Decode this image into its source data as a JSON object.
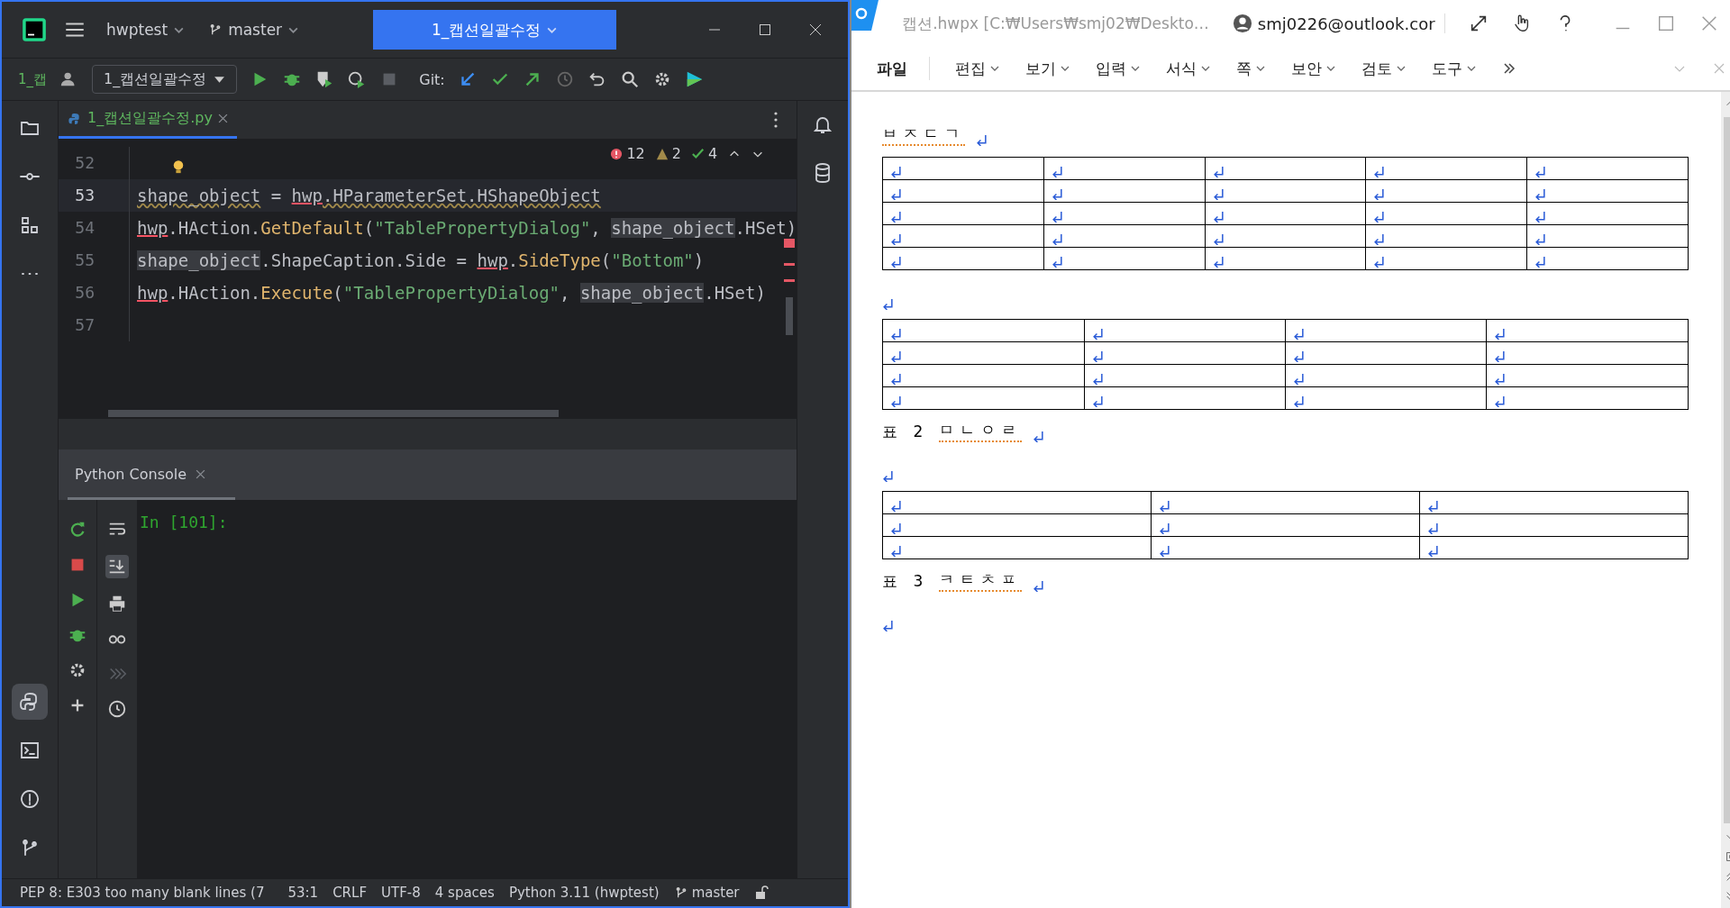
{
  "ide": {
    "title_bar": {
      "project": "hwptest",
      "branch": "master",
      "run_config": "1_캡션일괄수정"
    },
    "toolbar": {
      "project_short": "1_캡",
      "config": "1_캡션일괄수정",
      "git_label": "Git:"
    },
    "editor_tab": {
      "label": "1_캡션일괄수정.py",
      "selected": true
    },
    "inspections": {
      "errors": "12",
      "warnings": "2",
      "weak": "4"
    },
    "code_lines": [
      {
        "number": "52",
        "selected": false
      },
      {
        "number": "53",
        "selected": true,
        "tokens": [
          {
            "kind": "warn",
            "text": "shape_object"
          },
          {
            "kind": "plain",
            "text": " = "
          },
          {
            "kind": "module",
            "text": "hwp"
          },
          {
            "kind": "warn",
            "text": ".HParameterSet.HShapeObject"
          }
        ]
      },
      {
        "number": "54",
        "selected": false,
        "tokens": [
          {
            "kind": "module",
            "text": "hwp"
          },
          {
            "kind": "plain",
            "text": ".HAction."
          },
          {
            "kind": "call",
            "text": "GetDefault"
          },
          {
            "kind": "plain",
            "text": "("
          },
          {
            "kind": "str",
            "text": "\"TablePropertyDialog\""
          },
          {
            "kind": "plain",
            "text": ", "
          },
          {
            "kind": "name",
            "text": "shape_object"
          },
          {
            "kind": "plain",
            "text": ".HSet)"
          }
        ]
      },
      {
        "number": "55",
        "selected": false,
        "tokens": [
          {
            "kind": "name",
            "text": "shape_object"
          },
          {
            "kind": "plain",
            "text": ".ShapeCaption.Side = "
          },
          {
            "kind": "module",
            "text": "hwp"
          },
          {
            "kind": "plain",
            "text": "."
          },
          {
            "kind": "call",
            "text": "SideType"
          },
          {
            "kind": "plain",
            "text": "("
          },
          {
            "kind": "str",
            "text": "\"Bottom\""
          },
          {
            "kind": "plain",
            "text": ")"
          }
        ]
      },
      {
        "number": "56",
        "selected": false,
        "tokens": [
          {
            "kind": "module",
            "text": "hwp"
          },
          {
            "kind": "plain",
            "text": ".HAction."
          },
          {
            "kind": "call",
            "text": "Execute"
          },
          {
            "kind": "plain",
            "text": "("
          },
          {
            "kind": "str",
            "text": "\"TablePropertyDialog\""
          },
          {
            "kind": "plain",
            "text": ", "
          },
          {
            "kind": "name",
            "text": "shape_object"
          },
          {
            "kind": "plain",
            "text": ".HSet)"
          }
        ]
      },
      {
        "number": "57",
        "selected": false
      }
    ],
    "left_tools_top": [
      {
        "kind": "folder",
        "selected": false
      },
      {
        "kind": "commit",
        "selected": false
      },
      {
        "kind": "structure",
        "selected": false
      },
      {
        "kind": "more",
        "selected": false
      }
    ],
    "left_tools_bottom": [
      {
        "kind": "python",
        "selected": true
      },
      {
        "kind": "terminal",
        "selected": false
      },
      {
        "kind": "problems",
        "selected": false
      },
      {
        "kind": "git",
        "selected": false
      }
    ],
    "console": {
      "tab": "Python Console",
      "prompt": "In [101]:"
    },
    "status_bar": [
      {
        "kind": "text",
        "text": "PEP 8: E303 too many blank lines (7"
      },
      {
        "kind": "text",
        "text": "53:1"
      },
      {
        "kind": "text",
        "text": "CRLF"
      },
      {
        "kind": "text",
        "text": "UTF-8"
      },
      {
        "kind": "text",
        "text": "4 spaces"
      },
      {
        "kind": "text",
        "text": "Python 3.11 (hwptest)"
      },
      {
        "kind": "branch",
        "text": "master"
      }
    ]
  },
  "hwp": {
    "title": "캡션.hwpx [C:₩Users₩smj02₩Deskto…",
    "account": "smj0226@outlook.cor",
    "menu": [
      {
        "label": "파일",
        "kind": "plain"
      },
      {
        "label": "편집",
        "kind": "dropdown"
      },
      {
        "label": "보기",
        "kind": "dropdown"
      },
      {
        "label": "입력",
        "kind": "dropdown"
      },
      {
        "label": "서식",
        "kind": "dropdown"
      },
      {
        "label": "쪽",
        "kind": "dropdown"
      },
      {
        "label": "보안",
        "kind": "dropdown"
      },
      {
        "label": "검토",
        "kind": "dropdown"
      },
      {
        "label": "도구",
        "kind": "dropdown"
      }
    ],
    "document": [
      {
        "kind": "caption",
        "text": "ㅂㅈㄷㄱ"
      },
      {
        "kind": "table",
        "rows": [
          [
            {
              "kind": "mark"
            },
            {
              "kind": "mark"
            },
            {
              "kind": "mark"
            },
            {
              "kind": "mark"
            },
            {
              "kind": "mark"
            }
          ],
          [
            {
              "kind": "mark"
            },
            {
              "kind": "mark"
            },
            {
              "kind": "mark"
            },
            {
              "kind": "mark"
            },
            {
              "kind": "mark"
            }
          ],
          [
            {
              "kind": "mark"
            },
            {
              "kind": "mark"
            },
            {
              "kind": "mark"
            },
            {
              "kind": "mark"
            },
            {
              "kind": "mark"
            }
          ],
          [
            {
              "kind": "mark"
            },
            {
              "kind": "mark"
            },
            {
              "kind": "mark"
            },
            {
              "kind": "mark"
            },
            {
              "kind": "mark"
            }
          ],
          [
            {
              "kind": "mark"
            },
            {
              "kind": "mark"
            },
            {
              "kind": "mark"
            },
            {
              "kind": "mark"
            },
            {
              "kind": "mark"
            }
          ]
        ]
      },
      {
        "kind": "blank"
      },
      {
        "kind": "table",
        "rows": [
          [
            {
              "kind": "mark"
            },
            {
              "kind": "mark"
            },
            {
              "kind": "mark"
            },
            {
              "kind": "mark"
            }
          ],
          [
            {
              "kind": "mark"
            },
            {
              "kind": "mark"
            },
            {
              "kind": "mark"
            },
            {
              "kind": "mark"
            }
          ],
          [
            {
              "kind": "mark"
            },
            {
              "kind": "mark"
            },
            {
              "kind": "mark"
            },
            {
              "kind": "mark"
            }
          ],
          [
            {
              "kind": "mark"
            },
            {
              "kind": "mark"
            },
            {
              "kind": "mark"
            },
            {
              "kind": "mark"
            }
          ]
        ]
      },
      {
        "kind": "caption",
        "prefix": "표 2",
        "text": "ㅁㄴㅇㄹ"
      },
      {
        "kind": "blank"
      },
      {
        "kind": "table",
        "rows": [
          [
            {
              "kind": "mark"
            },
            {
              "kind": "mark"
            },
            {
              "kind": "mark"
            }
          ],
          [
            {
              "kind": "mark"
            },
            {
              "kind": "mark"
            },
            {
              "kind": "mark"
            }
          ],
          [
            {
              "kind": "mark"
            },
            {
              "kind": "mark"
            },
            {
              "kind": "mark"
            }
          ]
        ]
      },
      {
        "kind": "caption",
        "prefix": "표 3",
        "text": "ㅋㅌㅊㅍ"
      },
      {
        "kind": "blank"
      }
    ]
  }
}
